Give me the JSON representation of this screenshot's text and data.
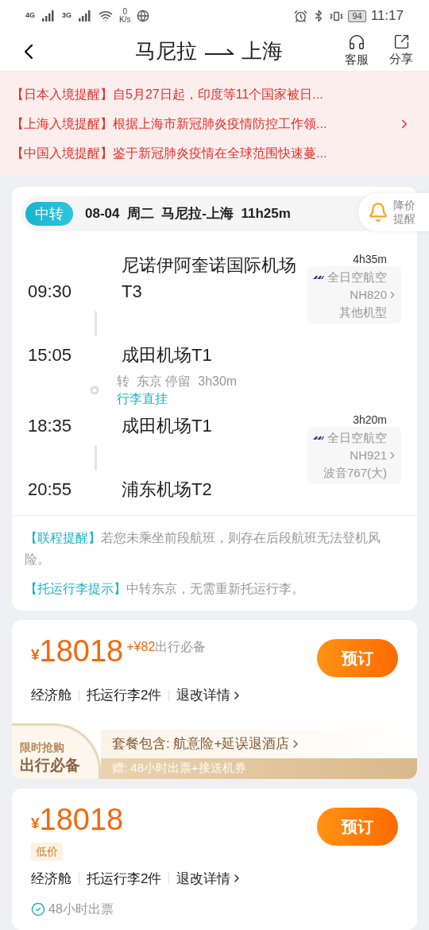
{
  "status_bar": {
    "network_1": "4G",
    "network_2": "3G",
    "speed_value": "0",
    "speed_unit": "K/s",
    "battery": "94",
    "time": "11:17"
  },
  "header": {
    "from": "马尼拉",
    "to": "上海",
    "actions": [
      {
        "kind": "headset",
        "label": "客服"
      },
      {
        "kind": "share",
        "label": "分享"
      }
    ]
  },
  "notices": [
    {
      "tag": "【日本入境提醒】",
      "text": "自5月27日起，印度等11个国家被日..."
    },
    {
      "tag": "【上海入境提醒】",
      "text": "根据上海市新冠肺炎疫情防控工作领..."
    },
    {
      "tag": "【中国入境提醒】",
      "text": "鉴于新冠肺炎疫情在全球范围快速蔓..."
    }
  ],
  "itinerary": {
    "badge": "中转",
    "summary": "08-04  周二  马尼拉-上海  11h25m",
    "price_alert": "降价提醒",
    "segments": [
      {
        "kind": "flight",
        "dep_time": "09:30",
        "dep_airport": "尼诺伊阿奎诺国际机场T3",
        "arr_time": "15:05",
        "arr_airport": "成田机场T1",
        "duration": "4h35m",
        "airline": "全日空航空",
        "flight_no": "NH820",
        "aircraft": "其他机型"
      },
      {
        "kind": "transfer",
        "text": "转  东京 停留  3h30m",
        "baggage": "行李直挂"
      },
      {
        "kind": "flight",
        "dep_time": "18:35",
        "dep_airport": "成田机场T1",
        "arr_time": "20:55",
        "arr_airport": "浦东机场T2",
        "duration": "3h20m",
        "airline": "全日空航空",
        "flight_no": "NH921",
        "aircraft": "波音767(大)"
      }
    ],
    "tips": [
      {
        "tag": "【联程提醒】",
        "text": "若您未乘坐前段航班，则存在后段航班无法登机风险。"
      },
      {
        "tag": "【托运行李提示】",
        "text": "中转东京，无需重新托运行李。"
      }
    ]
  },
  "offers": [
    {
      "currency": "¥",
      "price": "18018",
      "extra": "+¥82",
      "extra_label": "出行必备",
      "book": "预订",
      "details": [
        "经济舱",
        "托运行李2件",
        "退改详情"
      ],
      "package": {
        "badge_top": "限时抢购",
        "badge_main": "出行必备",
        "includes": "套餐包含: 航意险+延误退酒店",
        "gift": "赠: 48小时出票+接送机券"
      }
    },
    {
      "currency": "¥",
      "price": "18018",
      "tag": "低价",
      "book": "预订",
      "details": [
        "经济舱",
        "托运行李2件",
        "退改详情"
      ],
      "feature": "48小时出票"
    }
  ]
}
